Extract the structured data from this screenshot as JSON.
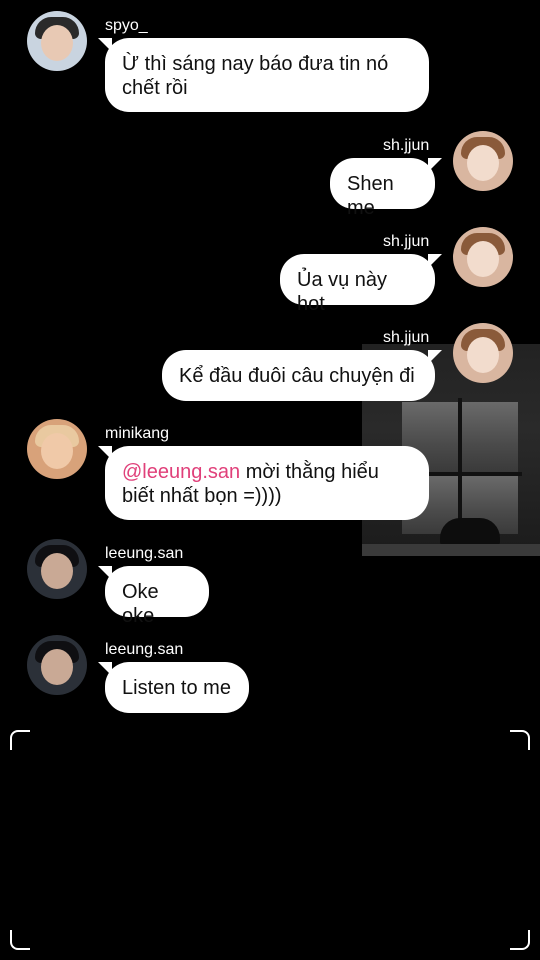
{
  "messages": [
    {
      "user": "spyo_",
      "side": "left",
      "avatar": "avatar-spyo",
      "text": "Ừ thì sáng nay báo đưa tin nó chết rồi"
    },
    {
      "user": "sh.jjun",
      "side": "right",
      "avatar": "avatar-shjjun",
      "text": "Shen me"
    },
    {
      "user": "sh.jjun",
      "side": "right",
      "avatar": "avatar-shjjun",
      "text": "Ủa vụ này hot"
    },
    {
      "user": "sh.jjun",
      "side": "right",
      "avatar": "avatar-shjjun",
      "text": "Kể đầu đuôi câu chuyện đi"
    },
    {
      "user": "minikang",
      "side": "left",
      "avatar": "avatar-minikang",
      "mention": "@leeung.san",
      "text": " mời thằng hiểu biết nhất bọn =))))"
    },
    {
      "user": "leeung.san",
      "side": "left",
      "avatar": "avatar-leeungsan",
      "text": "Oke oke"
    },
    {
      "user": "leeung.san",
      "side": "left",
      "avatar": "avatar-leeungsan",
      "text": "Listen to me"
    }
  ],
  "colors": {
    "background": "#000000",
    "bubble": "#ffffff",
    "bubble_text": "#111111",
    "mention": "#e0407a",
    "username": "#ffffff"
  }
}
